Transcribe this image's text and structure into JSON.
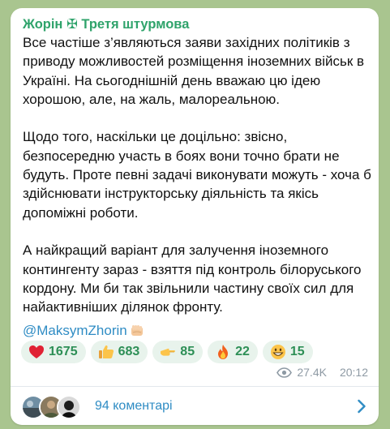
{
  "post": {
    "channel_title": "Жорін ✠ Третя штурмова",
    "paragraphs": [
      "Все частіше з’являються заяви західних політиків з приводу можливостей розміщення іноземних військ в Україні. На сьогоднішній день вважаю цю ідею хорошою, але, на жаль, малореальною.",
      "Щодо того, наскільки це доцільно: звісно, безпосередню участь в боях вони точно брати не будуть. Проте певні задачі виконувати можуть - хоча б здійснювати інструкторську діяльність та якісь допоміжні роботи.",
      "А найкращий варіант для залучення іноземного контингенту зараз - взяття під контроль білоруського кордону. Ми би так звільнили частину своїх сил для найактивніших ділянок фронту."
    ],
    "author_link": "@MaksymZhorin",
    "author_emoji_icon": "fist-emoji-icon"
  },
  "reactions": [
    {
      "icon": "red-heart-icon",
      "count": "1675"
    },
    {
      "icon": "thumbs-up-icon",
      "count": "683"
    },
    {
      "icon": "pointing-hand-icon",
      "count": "85"
    },
    {
      "icon": "fire-icon",
      "count": "22"
    },
    {
      "icon": "grinning-face-icon",
      "count": "15"
    }
  ],
  "meta": {
    "views_icon": "eye-icon",
    "views": "27.4K",
    "time": "20:12"
  },
  "comments": {
    "label": "94 коментарі",
    "chevron_icon": "chevron-right-icon"
  },
  "colors": {
    "background": "#a9c58f",
    "channel_title": "#2fa36b",
    "link": "#2f8cc4",
    "reaction_bg": "#e8f3ec",
    "reaction_count": "#2d8f56",
    "meta": "#8e9aa4"
  }
}
